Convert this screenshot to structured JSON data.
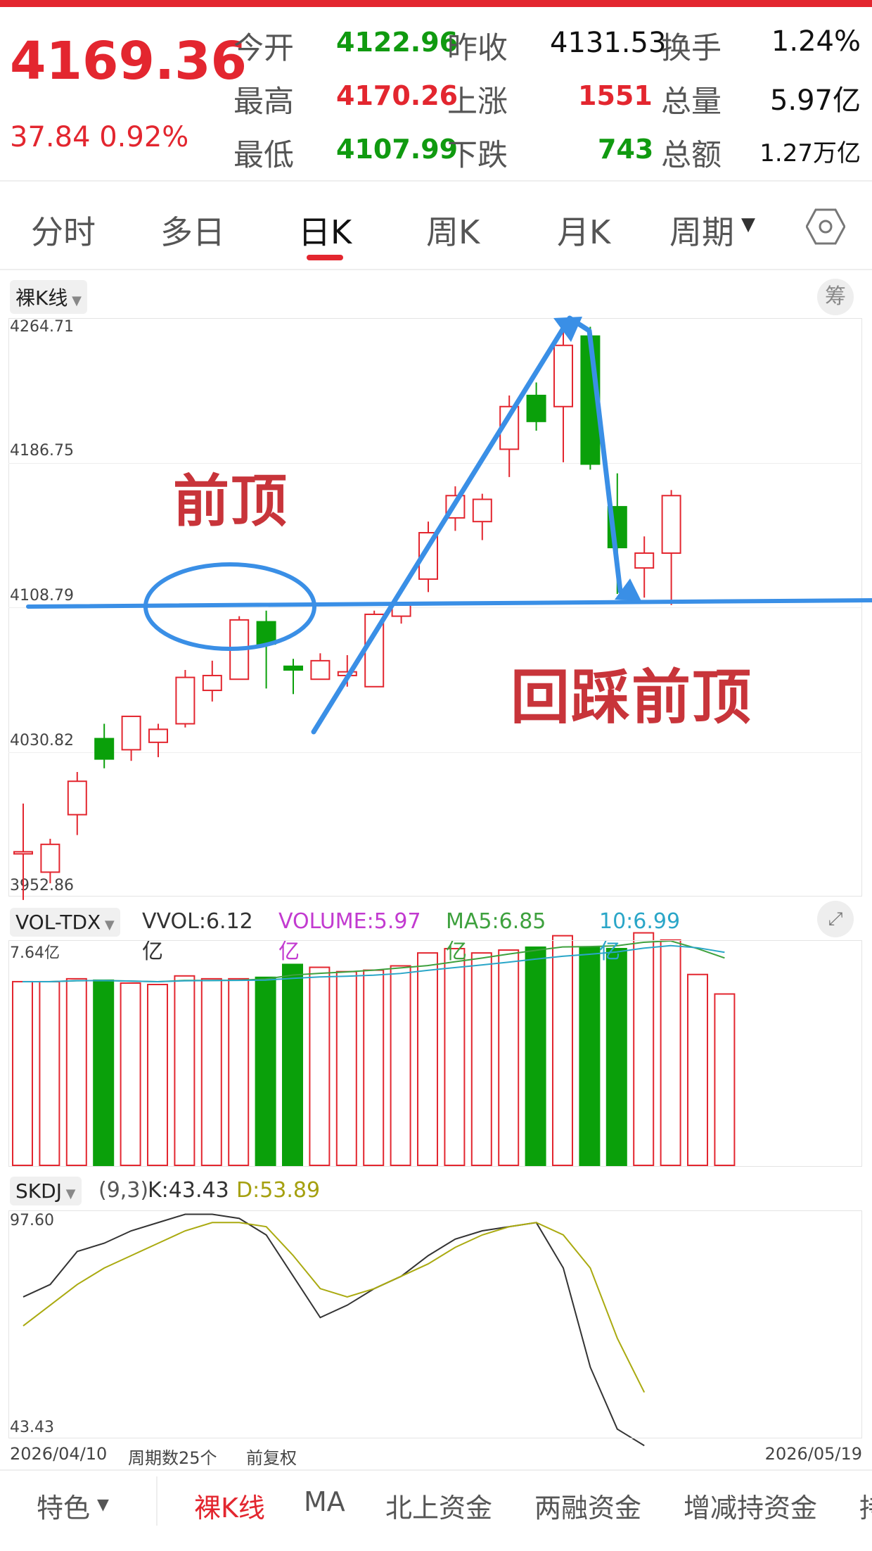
{
  "quote": {
    "price": "4169.36",
    "change": "37.84 0.92%",
    "open_label": "今开",
    "open": "4122.96",
    "prev_close_label": "昨收",
    "prev_close": "4131.53",
    "turnover_label": "换手",
    "turnover": "1.24%",
    "high_label": "最高",
    "high": "4170.26",
    "rise_label": "上涨",
    "rise": "1551",
    "volume_label": "总量",
    "volume": "5.97亿",
    "low_label": "最低",
    "low": "4107.99",
    "fall_label": "下跌",
    "fall": "743",
    "amount_label": "总额",
    "amount": "1.27万亿"
  },
  "tabs": [
    "分时",
    "多日",
    "日K",
    "周K",
    "月K",
    "周期"
  ],
  "active_tab": "日K",
  "chart": {
    "mode_label": "裸K线",
    "chip_label": "筹",
    "price_ticks": [
      "4264.71",
      "4186.75",
      "4108.79",
      "4030.82",
      "3952.86"
    ],
    "annotations": {
      "prev_top": "前顶",
      "retest": "回踩前顶"
    },
    "date_start": "2026/04/10",
    "period_count": "周期数25个",
    "adjust": "前复权",
    "date_end": "2026/05/19"
  },
  "volume_panel": {
    "label": "VOL-TDX",
    "vvol": "VVOL:6.12亿",
    "volume": "VOLUME:5.97亿",
    "ma5": "MA5:6.85亿",
    "ma10": "10:6.99亿",
    "top_tick": "7.64亿"
  },
  "skdj_panel": {
    "label": "SKDJ",
    "params": "(9,3)",
    "k": "K:43.43",
    "d": "D:53.89",
    "top_tick": "97.60",
    "bottom_tick": "43.43"
  },
  "footer": [
    "特色",
    "裸K线",
    "MA",
    "北上资金",
    "两融资金",
    "增减持资金",
    "持"
  ],
  "colors": {
    "up": "#e3262f",
    "down": "#0aa00a",
    "annotation": "#3a8fe6",
    "k_line": "#333333",
    "d_line": "#aaaa10"
  },
  "chart_data": [
    {
      "type": "candlestick",
      "title": "日K",
      "ylim": [
        3952.86,
        4264.71
      ],
      "candles": [
        {
          "o": 3976,
          "h": 4003,
          "l": 3951,
          "c": 3977
        },
        {
          "o": 3966,
          "h": 3984,
          "l": 3960,
          "c": 3981
        },
        {
          "o": 3997,
          "h": 4020,
          "l": 3986,
          "c": 4015
        },
        {
          "o": 4038,
          "h": 4046,
          "l": 4022,
          "c": 4027
        },
        {
          "o": 4032,
          "h": 4050,
          "l": 4026,
          "c": 4050
        },
        {
          "o": 4036,
          "h": 4046,
          "l": 4028,
          "c": 4043
        },
        {
          "o": 4046,
          "h": 4075,
          "l": 4044,
          "c": 4071
        },
        {
          "o": 4064,
          "h": 4080,
          "l": 4058,
          "c": 4072
        },
        {
          "o": 4070,
          "h": 4104,
          "l": 4070,
          "c": 4102
        },
        {
          "o": 4101,
          "h": 4107,
          "l": 4065,
          "c": 4089
        },
        {
          "o": 4077,
          "h": 4081,
          "l": 4062,
          "c": 4075
        },
        {
          "o": 4070,
          "h": 4084,
          "l": 4071,
          "c": 4080
        },
        {
          "o": 4072,
          "h": 4083,
          "l": 4066,
          "c": 4074
        },
        {
          "o": 4066,
          "h": 4107,
          "l": 4066,
          "c": 4105
        },
        {
          "o": 4104,
          "h": 4111,
          "l": 4100,
          "c": 4110
        },
        {
          "o": 4124,
          "h": 4155,
          "l": 4117,
          "c": 4149
        },
        {
          "o": 4157,
          "h": 4174,
          "l": 4150,
          "c": 4169
        },
        {
          "o": 4155,
          "h": 4170,
          "l": 4145,
          "c": 4167
        },
        {
          "o": 4194,
          "h": 4223,
          "l": 4179,
          "c": 4217
        },
        {
          "o": 4223,
          "h": 4230,
          "l": 4204,
          "c": 4209
        },
        {
          "o": 4217,
          "h": 4259,
          "l": 4187,
          "c": 4250
        },
        {
          "o": 4255,
          "h": 4260,
          "l": 4183,
          "c": 4186
        },
        {
          "o": 4163,
          "h": 4181,
          "l": 4116,
          "c": 4141
        },
        {
          "o": 4130,
          "h": 4147,
          "l": 4114,
          "c": 4138
        },
        {
          "o": 4138,
          "h": 4172,
          "l": 4110,
          "c": 4169
        }
      ]
    },
    {
      "type": "bar",
      "title": "VOL-TDX",
      "ylim": [
        0,
        7.64
      ],
      "values": [
        6.4,
        6.4,
        6.5,
        6.45,
        6.35,
        6.3,
        6.6,
        6.5,
        6.5,
        6.55,
        7.0,
        6.9,
        6.75,
        6.8,
        6.95,
        7.4,
        7.55,
        7.4,
        7.5,
        7.6,
        8.0,
        7.6,
        7.55,
        8.1,
        7.85,
        6.65,
        5.97
      ]
    },
    {
      "type": "line",
      "title": "SKDJ",
      "ylim": [
        43.43,
        97.6
      ],
      "series": [
        {
          "name": "K",
          "values": [
            77,
            80,
            88,
            90,
            93,
            95,
            97,
            97,
            96,
            92,
            82,
            72,
            75,
            79,
            82,
            87,
            91,
            93,
            94,
            95,
            84,
            60,
            45,
            41
          ]
        },
        {
          "name": "D",
          "values": [
            70,
            75,
            80,
            84,
            87,
            90,
            93,
            95,
            95,
            94,
            87,
            79,
            77,
            79,
            82,
            85,
            89,
            92,
            94,
            95,
            92,
            84,
            67,
            53.89
          ]
        }
      ]
    }
  ]
}
